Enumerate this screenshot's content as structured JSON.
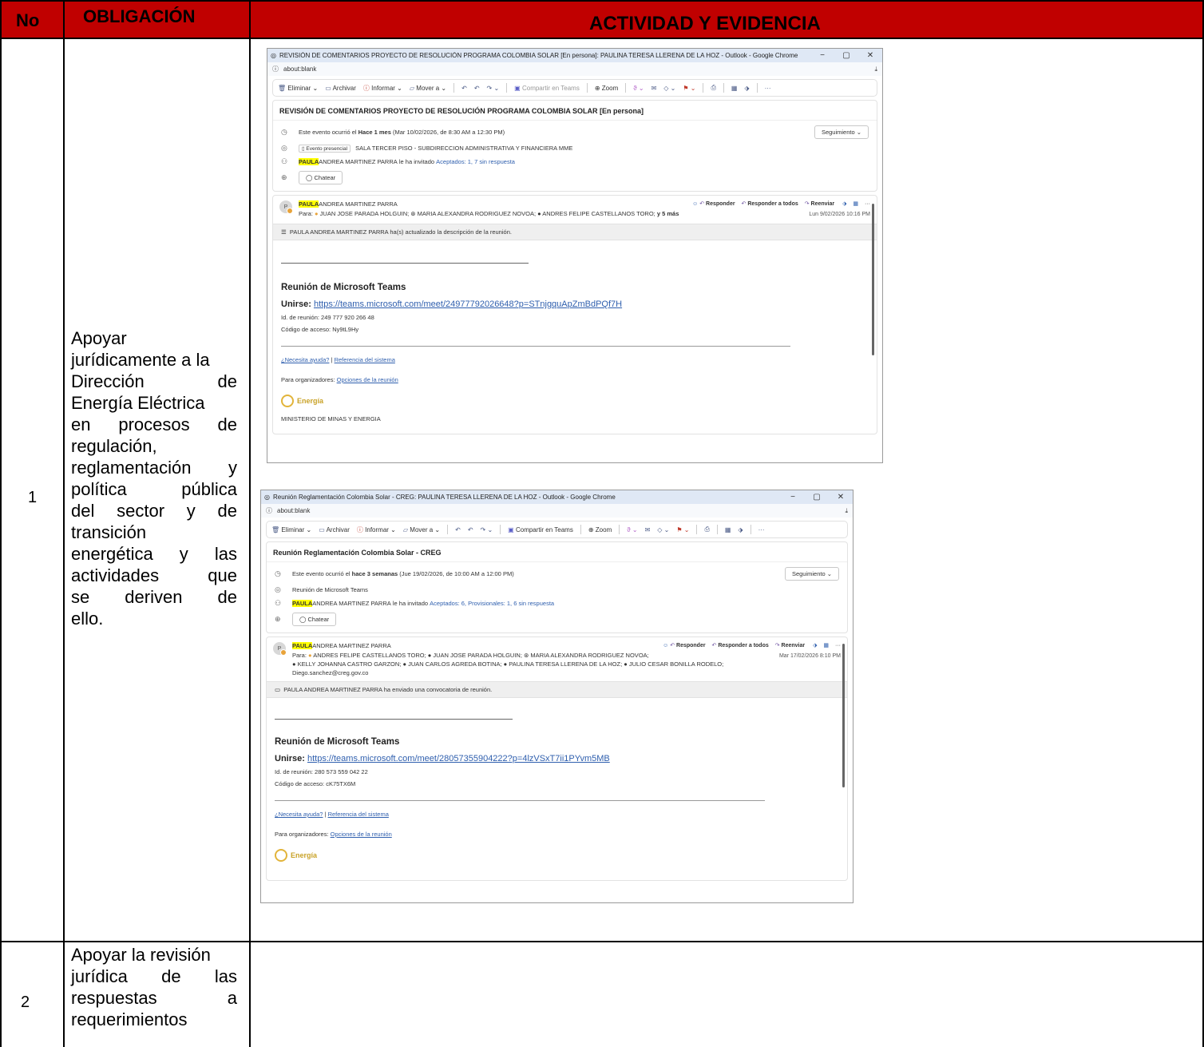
{
  "table": {
    "headers": {
      "no": "No",
      "obligacion": "OBLIGACIÓN",
      "actividad": "ACTIVIDAD Y EVIDENCIA"
    },
    "rows": [
      {
        "no": "1",
        "obligacion_lines": [
          "Apoyar",
          "jurídicamente a la",
          "Dirección de",
          "Energía Eléctrica",
          "en procesos de",
          "regulación,",
          "reglamentación y",
          "política pública",
          "del sector y de",
          "transición",
          "energética y las",
          "actividades que",
          "se deriven de",
          "ello."
        ]
      },
      {
        "no": "2",
        "obligacion_lines": [
          "Apoyar la revisión",
          "jurídica de las",
          "respuestas a",
          "requerimientos"
        ]
      }
    ]
  },
  "shot1": {
    "window_title": "REVISIÓN DE COMENTARIOS PROYECTO DE RESOLUCIÓN PROGRAMA COLOMBIA SOLAR [En persona]: PAULINA TERESA LLERENA DE LA HOZ - Outlook - Google Chrome",
    "url": "about:blank",
    "toolbar": [
      "Eliminar",
      "Archivar",
      "Informar",
      "Mover a",
      "Compartir en Teams",
      "Zoom"
    ],
    "subject": "REVISIÓN DE COMENTARIOS PROYECTO DE RESOLUCIÓN PROGRAMA COLOMBIA SOLAR [En persona]",
    "event_prefix": "Este evento ocurrió el ",
    "event_bold": "Hace 1 mes",
    "event_suffix": " (Mar 10/02/2026, de 8:30 AM a 12:30 PM)",
    "follow": "Seguimiento ⌄",
    "location_tag": "Evento presencial",
    "location": "SALA TERCER PISO - SUBDIRECCION ADMINISTRATIVA Y FINANCIERA MME",
    "inviter_hl": "PAULA",
    "inviter_rest": "ANDREA MARTINEZ PARRA",
    "invited_text": " le ha invitado ",
    "responses": "Aceptados: 1, 7 sin respuesta",
    "chat": "Chatear",
    "sender_hl": "PAULA",
    "sender_rest": "ANDREA MARTINEZ PARRA",
    "avatar": "P",
    "reply": "Responder",
    "reply_all": "Responder a todos",
    "forward": "Reenviar",
    "to_label": "Para:",
    "recipients": "JUAN JOSE PARADA HOLGUIN;  ⊛ MARIA ALEXANDRA RODRIGUEZ NOVOA;  ● ANDRES FELIPE CASTELLANOS TORO;",
    "more": "y 5 más",
    "date": "Lun 9/02/2026 10:16 PM",
    "notice": "PAULA ANDREA MARTINEZ PARRA ha(s) actualizado la descripción de la reunión.",
    "teams_title": "Reunión de Microsoft Teams",
    "join_label": "Unirse: ",
    "join_link": "https://teams.microsoft.com/meet/24977792026648?p=STnjgquApZmBdPQf7H",
    "meeting_id": "Id. de reunión: 249 777 920 266 48",
    "passcode": "Código de acceso: Ny9tL9Hy",
    "help": "¿Necesita ayuda?",
    "sys_ref": "Referencia del sistema",
    "organizers": "Para organizadores: ",
    "options": "Opciones de la reunión",
    "energia": "Energía",
    "ministry": "MINISTERIO DE MINAS Y ENERGIA"
  },
  "shot2": {
    "window_title": "Reunión Reglamentación Colombia Solar - CREG: PAULINA TERESA LLERENA DE LA HOZ - Outlook - Google Chrome",
    "url": "about:blank",
    "toolbar": [
      "Eliminar",
      "Archivar",
      "Informar",
      "Mover a",
      "Compartir en Teams",
      "Zoom"
    ],
    "subject": "Reunión Reglamentación Colombia Solar - CREG",
    "event_prefix": "Este evento ocurrió el ",
    "event_bold": "hace 3 semanas",
    "event_suffix": " (Jue 19/02/2026, de 10:00 AM a 12:00 PM)",
    "follow": "Seguimiento ⌄",
    "location": "Reunión de Microsoft Teams",
    "inviter_hl": "PAULA",
    "inviter_rest": "ANDREA MARTINEZ PARRA",
    "invited_text": " le ha invitado ",
    "responses": "Aceptados: 6, Provisionales: 1, 6 sin respuesta",
    "chat": "Chatear",
    "sender_hl": "PAULA",
    "sender_rest": "ANDREA MARTINEZ PARRA",
    "avatar": "P",
    "reply": "Responder",
    "reply_all": "Responder a todos",
    "forward": "Reenviar",
    "to_label": "Para:",
    "recipients_1": "ANDRES FELIPE CASTELLANOS TORO;  ● JUAN JOSE PARADA HOLGUIN;  ⊛ MARIA ALEXANDRA RODRIGUEZ NOVOA;",
    "recipients_2": "● KELLY JOHANNA CASTRO GARZON;  ● JUAN CARLOS AGREDA BOTINA;  ● PAULINA TERESA LLERENA DE LA HOZ;  ● JULIO CESAR BONILLA RODELO;",
    "recipients_3": "Diego.sanchez@creg.gov.co",
    "date": "Mar 17/02/2026 8:10 PM",
    "notice": "PAULA ANDREA MARTINEZ PARRA ha enviado una convocatoria de reunión.",
    "teams_title": "Reunión de Microsoft Teams",
    "join_label": "Unirse: ",
    "join_link": "https://teams.microsoft.com/meet/28057355904222?p=4lzVSxT7ii1PYvm5MB",
    "meeting_id": "Id. de reunión: 280 573 559 042 22",
    "passcode": "Código de acceso: cK75TX6M",
    "help": "¿Necesita ayuda?",
    "sys_ref": "Referencia del sistema",
    "organizers": "Para organizadores: ",
    "options": "Opciones de la reunión",
    "energia": "Energía"
  }
}
